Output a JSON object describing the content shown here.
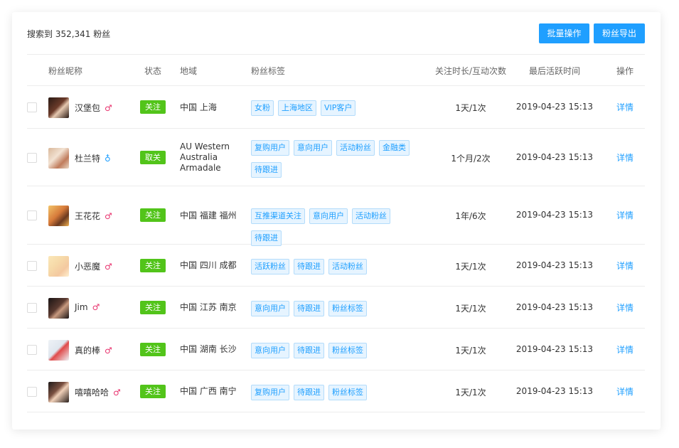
{
  "header": {
    "result_text": "搜索到 352,341 粉丝",
    "batch_button": "批量操作",
    "export_button": "粉丝导出"
  },
  "columns": {
    "nickname": "粉丝昵称",
    "status": "状态",
    "region": "地域",
    "tags": "粉丝标签",
    "duration": "关注时长/互动次数",
    "last_active": "最后活跃时间",
    "action": "操作"
  },
  "colors": {
    "accent": "#1f9fff",
    "status_follow": "#52c41a",
    "male": "#e8336e",
    "female": "#1f9fff"
  },
  "rows": [
    {
      "nickname": "汉堡包",
      "gender": "♂",
      "gender_type": "male",
      "status": "关注",
      "status_type": "follow",
      "region": [
        "中国 上海"
      ],
      "tags": [
        "女粉",
        "上海地区",
        "VIP客户"
      ],
      "duration": "1天/1次",
      "last_active": "2019-04-23 15:13",
      "action": "详情"
    },
    {
      "nickname": "杜兰特",
      "gender": "♁",
      "gender_type": "female",
      "status": "取关",
      "status_type": "unfollow",
      "region": [
        "AU Western",
        "Australia",
        "Armadale"
      ],
      "tags": [
        "复购用户",
        "意向用户",
        "活动粉丝",
        "金融类",
        "待跟进"
      ],
      "duration": "1个月/2次",
      "last_active": "2019-04-23 15:13",
      "action": "详情"
    },
    {
      "nickname": "王花花",
      "gender": "♂",
      "gender_type": "male",
      "status": "关注",
      "status_type": "follow",
      "region": [
        "中国 福建 福州"
      ],
      "tags": [
        "互推渠道关注",
        "意向用户",
        "活动粉丝",
        "待跟进"
      ],
      "duration": "1年/6次",
      "last_active": "2019-04-23 15:13",
      "action": "详情"
    },
    {
      "nickname": "小恶魔",
      "gender": "♂",
      "gender_type": "male",
      "status": "关注",
      "status_type": "follow",
      "region": [
        "中国 四川 成都"
      ],
      "tags": [
        "活跃粉丝",
        "待跟进",
        "活动粉丝"
      ],
      "duration": "1天/1次",
      "last_active": "2019-04-23 15:13",
      "action": "详情"
    },
    {
      "nickname": "Jim",
      "gender": "♂",
      "gender_type": "male",
      "status": "关注",
      "status_type": "follow",
      "region": [
        "中国 江苏 南京"
      ],
      "tags": [
        "意向用户",
        "待跟进",
        "粉丝标签"
      ],
      "duration": "1天/1次",
      "last_active": "2019-04-23 15:13",
      "action": "详情"
    },
    {
      "nickname": "真的棒",
      "gender": "♂",
      "gender_type": "male",
      "status": "关注",
      "status_type": "follow",
      "region": [
        "中国 湖南 长沙"
      ],
      "tags": [
        "意向用户",
        "待跟进",
        "粉丝标签"
      ],
      "duration": "1天/1次",
      "last_active": "2019-04-23 15:13",
      "action": "详情"
    },
    {
      "nickname": "嘻嘻哈哈",
      "gender": "♂",
      "gender_type": "male",
      "status": "关注",
      "status_type": "follow",
      "region": [
        "中国 广西 南宁"
      ],
      "tags": [
        "复购用户",
        "待跟进",
        "粉丝标签"
      ],
      "duration": "1天/1次",
      "last_active": "2019-04-23 15:13",
      "action": "详情"
    }
  ]
}
